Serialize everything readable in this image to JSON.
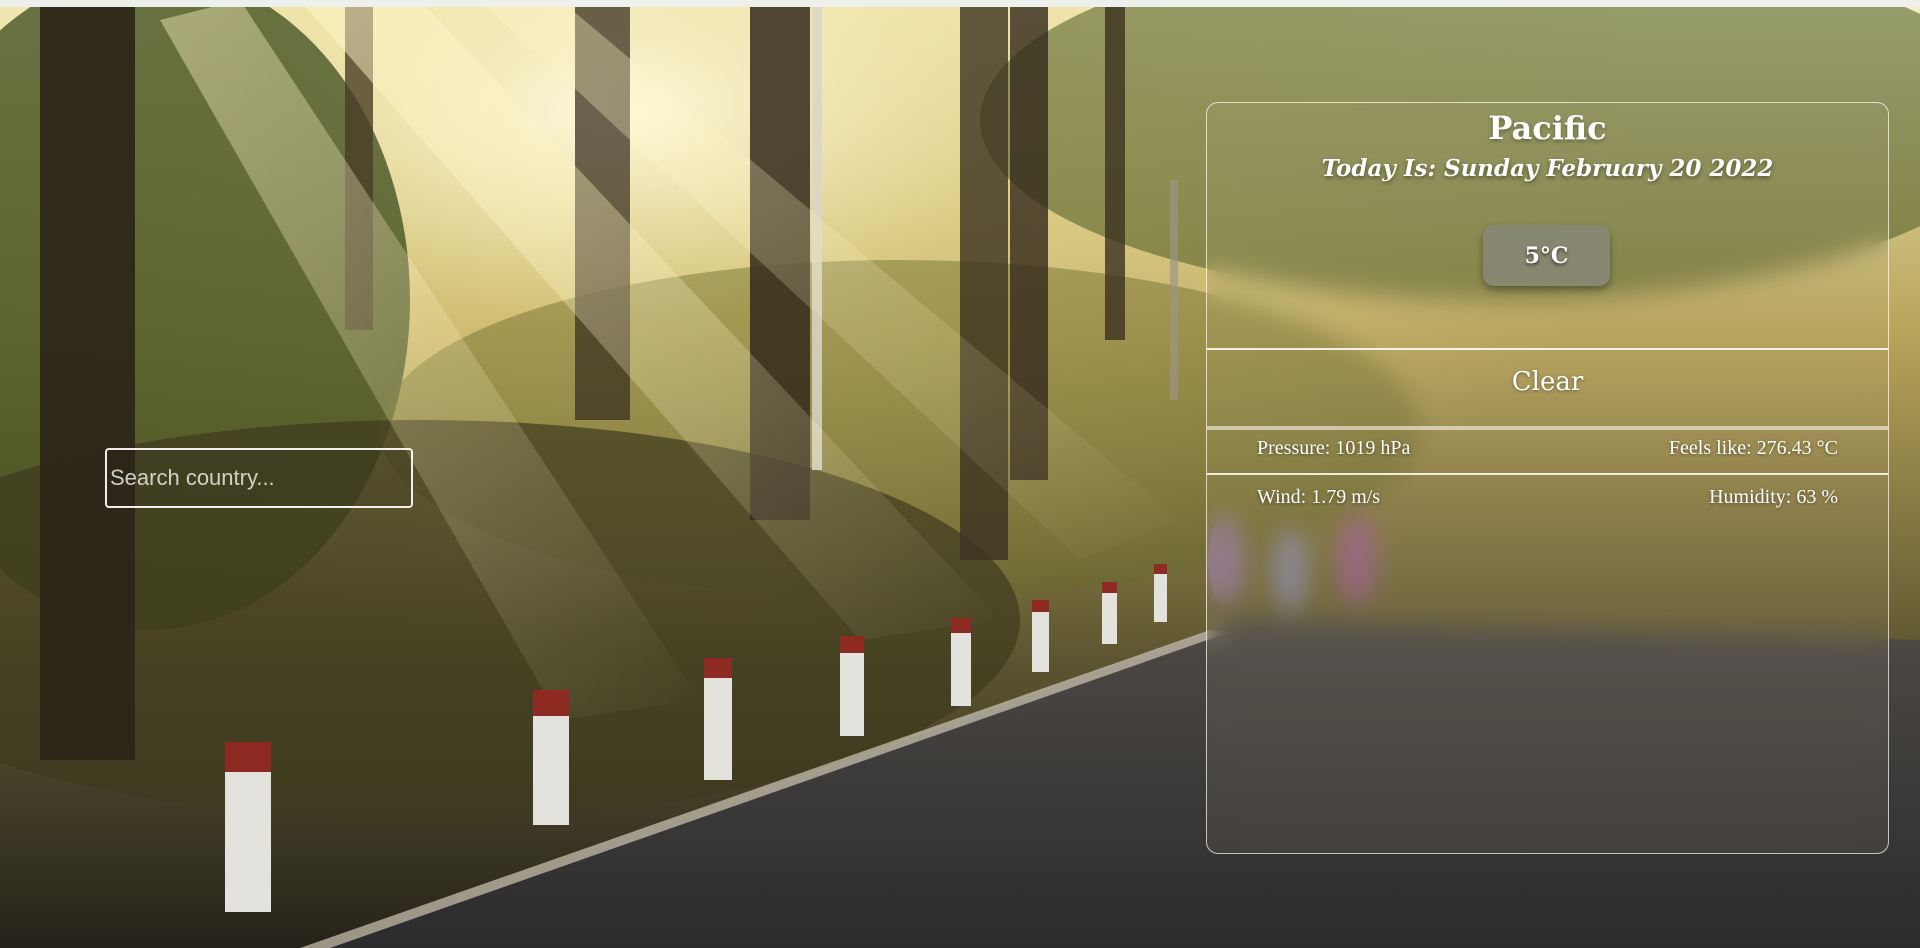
{
  "search": {
    "placeholder": "Search country..."
  },
  "weather": {
    "city": "Pacific",
    "date": "Today Is: Sunday February 20 2022",
    "temperature": "5°C",
    "condition": "Clear",
    "pressure": "Pressure: 1019 hPa",
    "feels_like": "Feels like: 276.43 °C",
    "wind": "Wind: 1.79 m/s",
    "humidity": "Humidity: 63 %"
  },
  "theme": {
    "card_border": "#ffffff",
    "text": "#ffffff",
    "temp_badge": "#87877d"
  },
  "background": {
    "image_icon": "forest-road-sunbeams-image"
  }
}
